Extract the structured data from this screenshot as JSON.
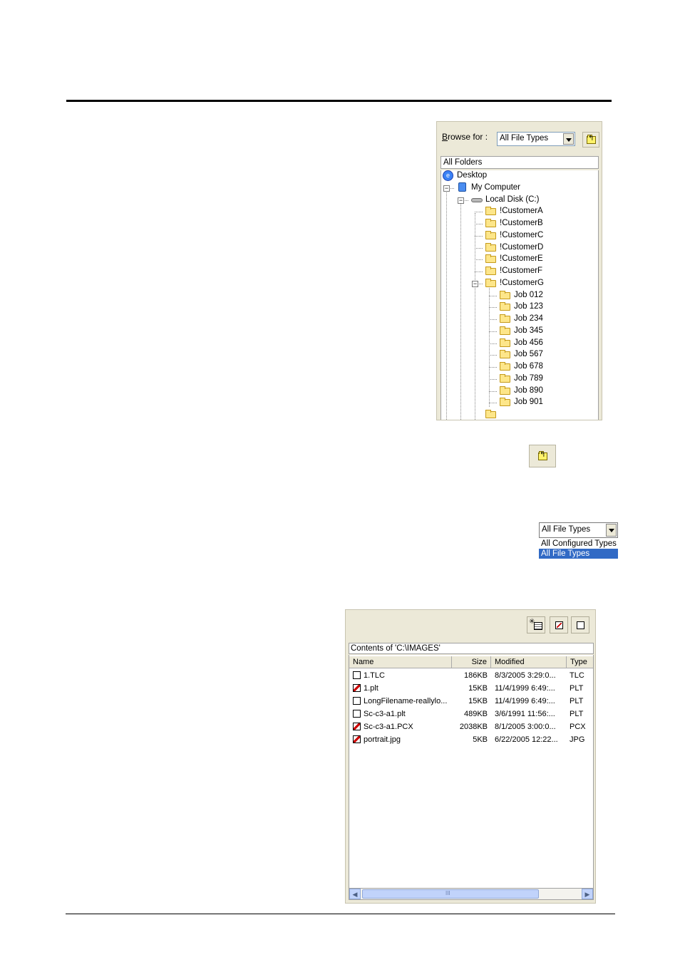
{
  "browse": {
    "label_underlined": "B",
    "label_rest": "rowse for :",
    "file_type_value": "All File Types",
    "folders_header": "All Folders",
    "tree": [
      {
        "label": "Desktop",
        "icon": "desktop-icon"
      },
      {
        "label": "My Computer",
        "icon": "computer-icon"
      },
      {
        "label": "Local Disk (C:)",
        "icon": "disk-icon"
      },
      {
        "label": "!CustomerA",
        "icon": "folder-icon"
      },
      {
        "label": "!CustomerB",
        "icon": "folder-icon"
      },
      {
        "label": "!CustomerC",
        "icon": "folder-icon"
      },
      {
        "label": "!CustomerD",
        "icon": "folder-icon"
      },
      {
        "label": "!CustomerE",
        "icon": "folder-icon"
      },
      {
        "label": "!CustomerF",
        "icon": "folder-icon"
      },
      {
        "label": "!CustomerG",
        "icon": "folder-icon"
      },
      {
        "label": "Job 012",
        "icon": "folder-icon"
      },
      {
        "label": "Job 123",
        "icon": "folder-icon"
      },
      {
        "label": "Job 234",
        "icon": "folder-icon"
      },
      {
        "label": "Job 345",
        "icon": "folder-icon"
      },
      {
        "label": "Job 456",
        "icon": "folder-icon"
      },
      {
        "label": "Job 567",
        "icon": "folder-icon"
      },
      {
        "label": "Job 678",
        "icon": "folder-icon"
      },
      {
        "label": "Job 789",
        "icon": "folder-icon"
      },
      {
        "label": "Job 890",
        "icon": "folder-icon"
      },
      {
        "label": "Job 901",
        "icon": "folder-icon"
      }
    ]
  },
  "dropdown": {
    "value": "All File Types",
    "options": [
      "All Configured Types",
      "All File Types"
    ],
    "selected_index": 1
  },
  "files": {
    "contents_header": "Contents of 'C:\\IMAGES'",
    "columns": [
      "Name",
      "Size",
      "Modified",
      "Type"
    ],
    "rows": [
      {
        "checked": false,
        "name": "1.TLC",
        "size": "186KB",
        "modified": "8/3/2005 3:29:0...",
        "type": "TLC"
      },
      {
        "checked": true,
        "name": "1.plt",
        "size": "15KB",
        "modified": "11/4/1999 6:49:...",
        "type": "PLT"
      },
      {
        "checked": false,
        "name": "LongFilename-reallylo...",
        "size": "15KB",
        "modified": "11/4/1999 6:49:...",
        "type": "PLT"
      },
      {
        "checked": false,
        "name": "Sc-c3-a1.plt",
        "size": "489KB",
        "modified": "3/6/1991 11:56:...",
        "type": "PLT"
      },
      {
        "checked": true,
        "name": "Sc-c3-a1.PCX",
        "size": "2038KB",
        "modified": "8/1/2005 3:00:0...",
        "type": "PCX"
      },
      {
        "checked": true,
        "name": "portrait.jpg",
        "size": "5KB",
        "modified": "6/22/2005 12:22...",
        "type": "JPG"
      }
    ],
    "scroll_thumb_glyph": "III"
  }
}
